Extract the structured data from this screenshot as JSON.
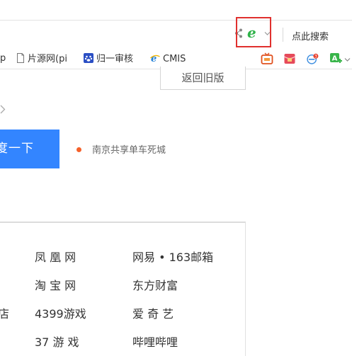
{
  "browser": {
    "address_bar": {
      "engine_letter": "e",
      "engine_color": "#2fb34a",
      "highlight_color": "#e0302e",
      "search_here_label": "点此搜索"
    },
    "bookmarks": [
      {
        "label": "p",
        "icon": "none"
      },
      {
        "label": "片源网(pi",
        "icon": "page-icon"
      },
      {
        "label": "归一审核",
        "icon": "paw-icon"
      },
      {
        "label": "CMIS",
        "icon": "ie-e-icon"
      }
    ],
    "extensions": [
      {
        "name": "tv-extension-icon",
        "badge": ""
      },
      {
        "name": "red-envelope-extension-icon",
        "badge": ""
      },
      {
        "name": "mail-extension-icon",
        "badge": "3"
      },
      {
        "name": "translate-extension-icon",
        "badge": ""
      }
    ]
  },
  "page": {
    "old_version_button": "返回旧版",
    "search_button": "度一下",
    "hot_search": "南京共享单车死城",
    "sites": {
      "col0": [
        "店"
      ],
      "col1": [
        "凤 凰 网",
        "淘 宝 网",
        "4399游戏",
        "37 游 戏"
      ],
      "col2": [
        "网易 • 163邮箱",
        "东方财富",
        "爱 奇 艺",
        "哔哩哔哩"
      ]
    }
  }
}
